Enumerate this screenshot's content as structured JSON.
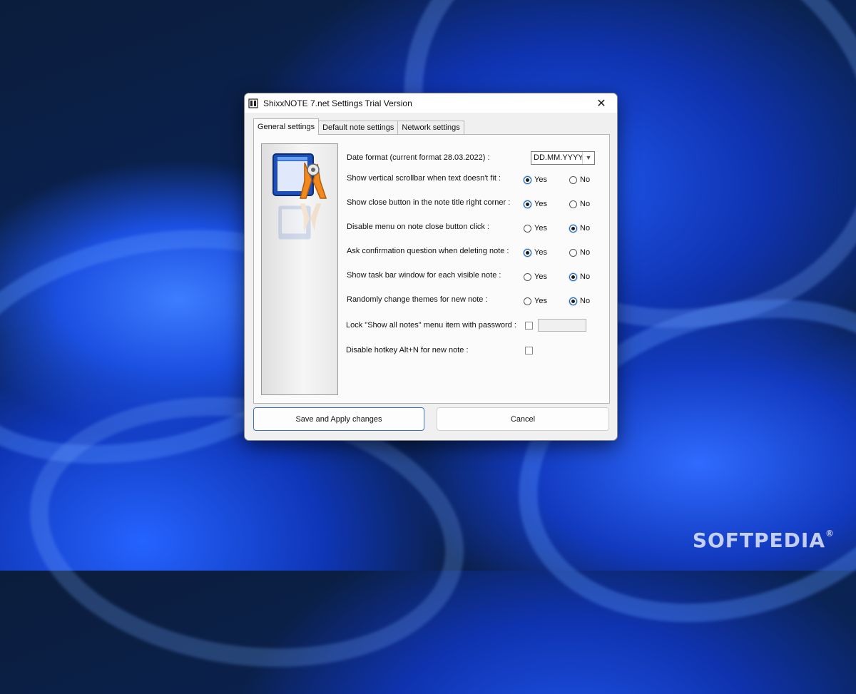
{
  "window": {
    "title": "ShixxNOTE 7.net Settings Trial Version",
    "close_glyph": "✕"
  },
  "tabs": [
    {
      "label": "General settings",
      "active": true
    },
    {
      "label": "Default note settings",
      "active": false
    },
    {
      "label": "Network settings",
      "active": false
    }
  ],
  "date_format": {
    "label": "Date format (current format 28.03.2022) :",
    "value": "DD.MM.YYYY"
  },
  "options": [
    {
      "label": "Show vertical scrollbar when text doesn't fit :",
      "selected": "Yes"
    },
    {
      "label": "Show close button in the note title right corner :",
      "selected": "Yes"
    },
    {
      "label": "Disable menu on note close button click :",
      "selected": "No"
    },
    {
      "label": "Ask confirmation question when deleting note :",
      "selected": "Yes"
    },
    {
      "label": "Show task bar window for each visible note :",
      "selected": "No"
    },
    {
      "label": "Randomly change themes for new note :",
      "selected": "No"
    }
  ],
  "radio_labels": {
    "yes": "Yes",
    "no": "No"
  },
  "lock_option": {
    "label": "Lock \"Show all notes\" menu item with password :",
    "checked": false,
    "password": ""
  },
  "hotkey_option": {
    "label": "Disable hotkey Alt+N for new note :",
    "checked": false
  },
  "buttons": {
    "save": "Save and Apply changes",
    "cancel": "Cancel"
  },
  "watermark": {
    "text": "SOFTPEDIA",
    "mark": "®"
  },
  "colors": {
    "accent": "#1f5fae",
    "desktop": "#0a2458"
  }
}
